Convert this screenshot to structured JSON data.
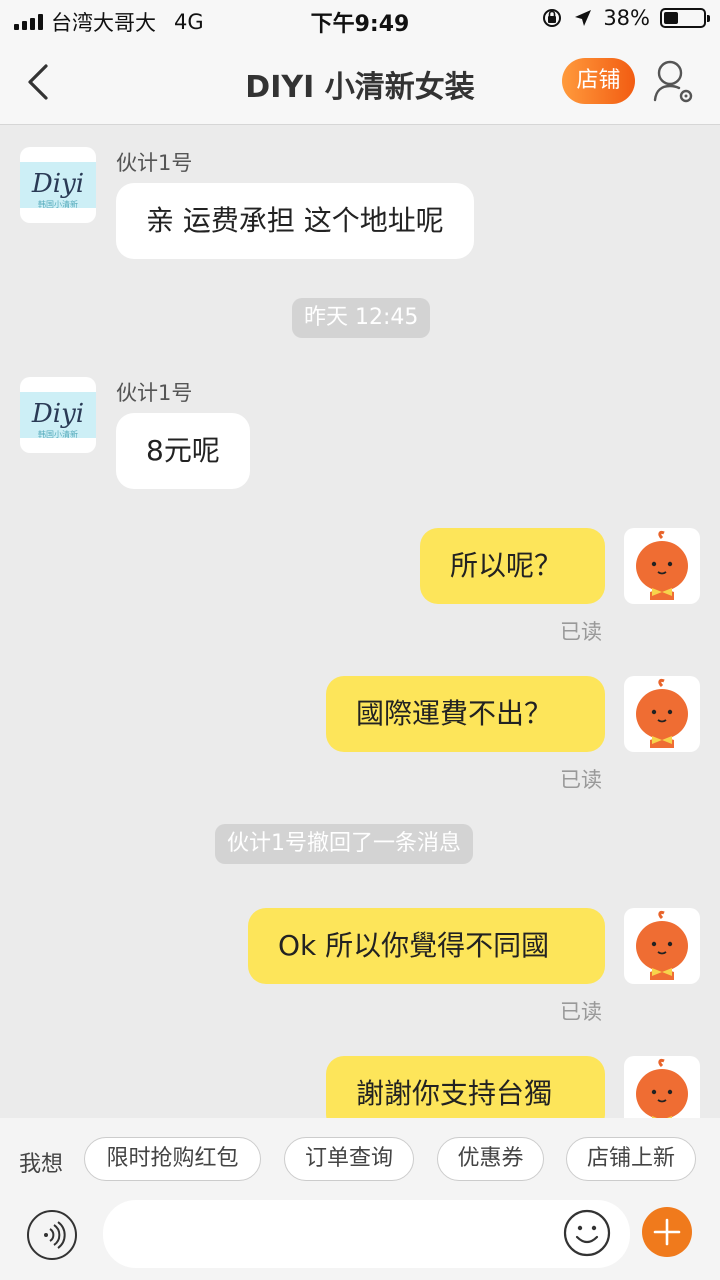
{
  "status_bar": {
    "carrier": "台湾大哥大",
    "network": "4G",
    "time": "下午9:49",
    "battery": "38%",
    "battery_level": 0.38
  },
  "nav": {
    "title": "DIYI 小清新女装",
    "shop_label": "店铺"
  },
  "chat": {
    "msg1": {
      "sender": "伙计1号",
      "text": "亲  运费承担 这个地址呢"
    },
    "timestamp": "昨天 12:45",
    "msg2": {
      "sender": "伙计1号",
      "text": "8元呢"
    },
    "msg3": {
      "text": "所以呢？",
      "status": "已读"
    },
    "msg4": {
      "text": "國際運費不出？",
      "status": "已读"
    },
    "recall_notice": "伙计1号撤回了一条消息",
    "msg5": {
      "text": "Ok 所以你覺得不同國",
      "status": "已读"
    },
    "msg6": {
      "text": "謝謝你支持台獨"
    },
    "shop_avatar": {
      "logo_text": "Diyi",
      "logo_sub": "韩国小清新"
    }
  },
  "quick_bar": {
    "label": "我想",
    "chips": [
      "限时抢购红包",
      "订单查询",
      "优惠券",
      "店铺上新"
    ]
  },
  "colors": {
    "accent": "#f07a1c",
    "bubble_self": "#fde55a",
    "bubble_other": "#ffffff",
    "background": "#ebebeb"
  }
}
